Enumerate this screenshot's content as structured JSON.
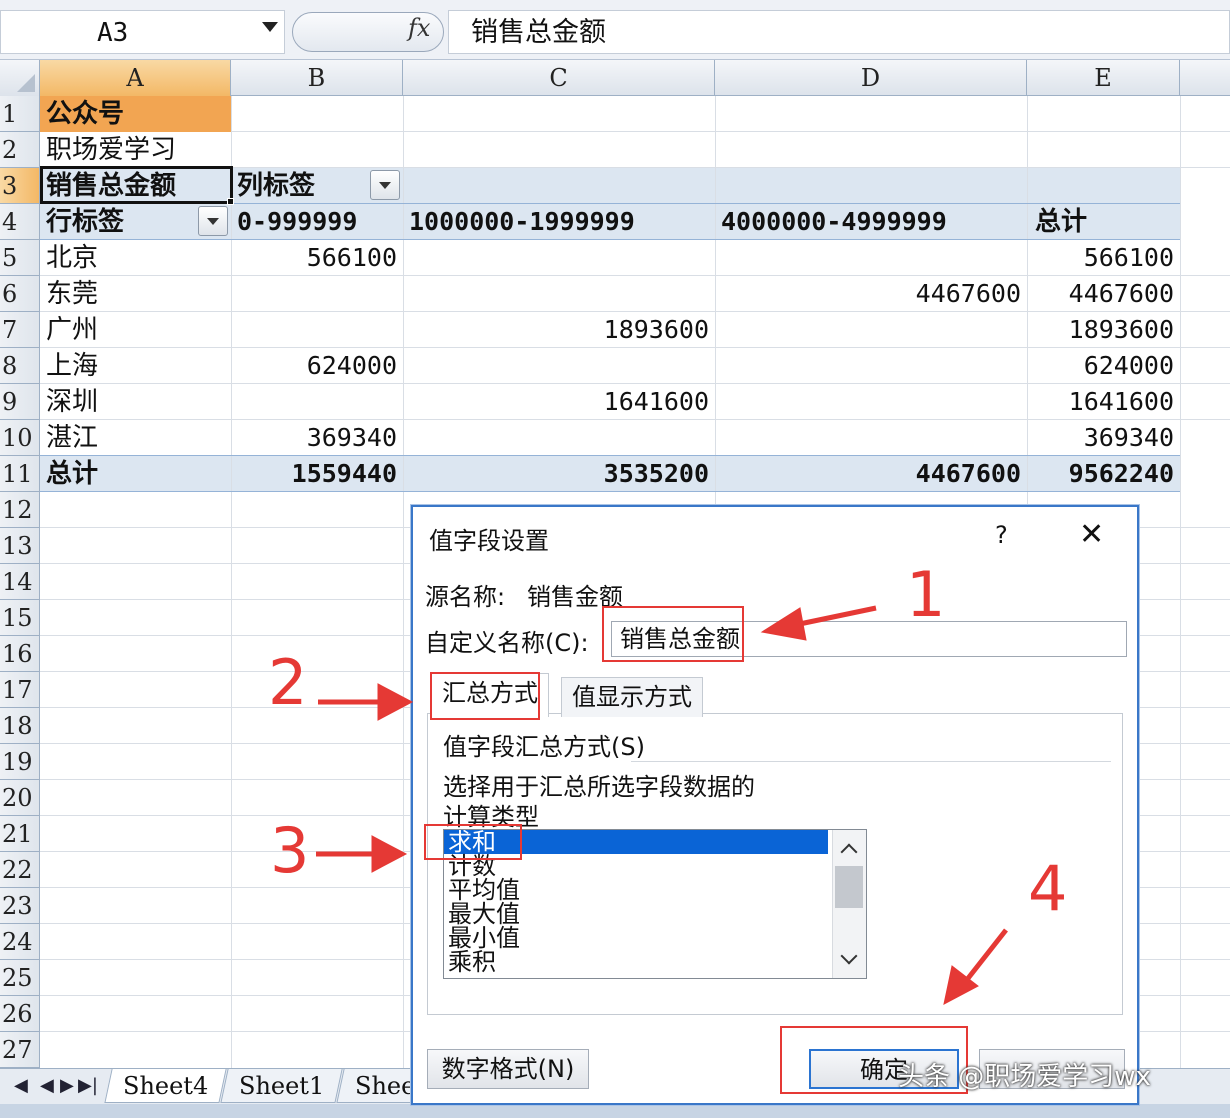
{
  "formula_bar": {
    "name_box": "A3",
    "fx_label": "fx",
    "formula": "销售总金额"
  },
  "columns": [
    "A",
    "B",
    "C",
    "D",
    "E"
  ],
  "rows": [
    "1",
    "2",
    "3",
    "4",
    "5",
    "6",
    "7",
    "8",
    "9",
    "10",
    "11",
    "12",
    "13",
    "14",
    "15",
    "16",
    "17",
    "18",
    "19",
    "20",
    "21",
    "22",
    "23",
    "24",
    "25",
    "26",
    "27"
  ],
  "sheet": {
    "a1": "公众号",
    "a2": "职场爱学习",
    "pivot": {
      "value_field": "销售总金额",
      "col_label": "列标签",
      "row_label": "行标签",
      "col_headers": [
        "0-999999",
        "1000000-1999999",
        "4000000-4999999",
        "总计"
      ],
      "rows": [
        {
          "name": "北京",
          "b": "566100",
          "c": "",
          "d": "",
          "e": "566100"
        },
        {
          "name": "东莞",
          "b": "",
          "c": "",
          "d": "4467600",
          "e": "4467600"
        },
        {
          "name": "广州",
          "b": "",
          "c": "1893600",
          "d": "",
          "e": "1893600"
        },
        {
          "name": "上海",
          "b": "624000",
          "c": "",
          "d": "",
          "e": "624000"
        },
        {
          "name": "深圳",
          "b": "",
          "c": "1641600",
          "d": "",
          "e": "1641600"
        },
        {
          "name": "湛江",
          "b": "369340",
          "c": "",
          "d": "",
          "e": "369340"
        }
      ],
      "total": {
        "name": "总计",
        "b": "1559440",
        "c": "3535200",
        "d": "4467600",
        "e": "9562240"
      }
    }
  },
  "sheet_tabs": [
    "Sheet4",
    "Sheet1",
    "Shee"
  ],
  "tab_nav": [
    "◀",
    "◀",
    "▶",
    "▶|"
  ],
  "dialog": {
    "title": "值字段设置",
    "help": "?",
    "close": "✕",
    "source_label": "源名称:",
    "source_value": "销售金额",
    "custom_label": "自定义名称(C):",
    "custom_value": "销售总金额",
    "tabs": [
      "汇总方式",
      "值显示方式"
    ],
    "group_title": "值字段汇总方式(S)",
    "desc_line1": "选择用于汇总所选字段数据的",
    "desc_line2": "计算类型",
    "options": [
      "求和",
      "计数",
      "平均值",
      "最大值",
      "最小值",
      "乘积"
    ],
    "number_format": "数字格式(N)",
    "ok": "确定"
  },
  "annotations": [
    "1",
    "2",
    "3",
    "4"
  ],
  "watermark": "头条 @职场爱学习wx",
  "colors": {
    "accent": "#e53935",
    "pivot_band": "#dce6f1",
    "selected": "#0a64d6",
    "header_selected": "#f3b866"
  }
}
